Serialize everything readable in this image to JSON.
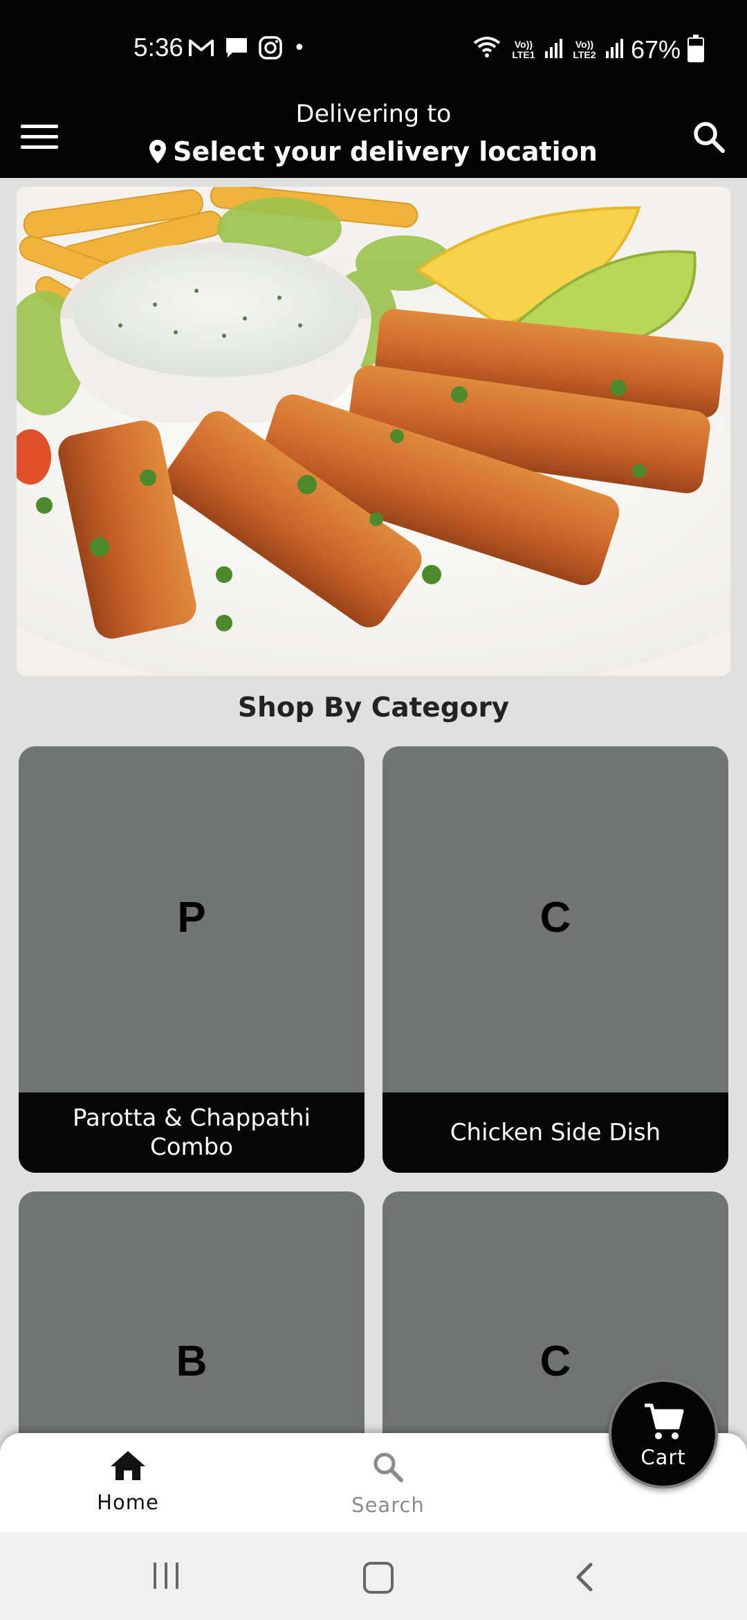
{
  "status_bar": {
    "time": "5:36",
    "left_icons": [
      "gmail-icon",
      "message-icon",
      "instagram-icon"
    ],
    "dot": "•",
    "sim1_label": "Vo)) LTE1",
    "sim2_label": "Vo)) LTE2",
    "battery": "67%",
    "battery_level": 0.67
  },
  "header": {
    "delivering_to": "Delivering to",
    "location": "Select your delivery location",
    "menu_icon": "hamburger-menu-icon",
    "search_icon": "search-icon"
  },
  "main": {
    "section_title": "Shop By Category",
    "categories": [
      {
        "letter": "P",
        "label": "Parotta & Chappathi Combo"
      },
      {
        "letter": "C",
        "label": "Chicken Side Dish"
      },
      {
        "letter": "B",
        "label": ""
      },
      {
        "letter": "C",
        "label": ""
      }
    ]
  },
  "bottom_nav": {
    "home_label": "Home",
    "search_label": "Search",
    "cart_label": "Cart"
  },
  "colors": {
    "header_bg": "#030303",
    "card_bg": "#727373",
    "card_label_bg": "#060606",
    "page_bg": "#e0e0e0"
  }
}
